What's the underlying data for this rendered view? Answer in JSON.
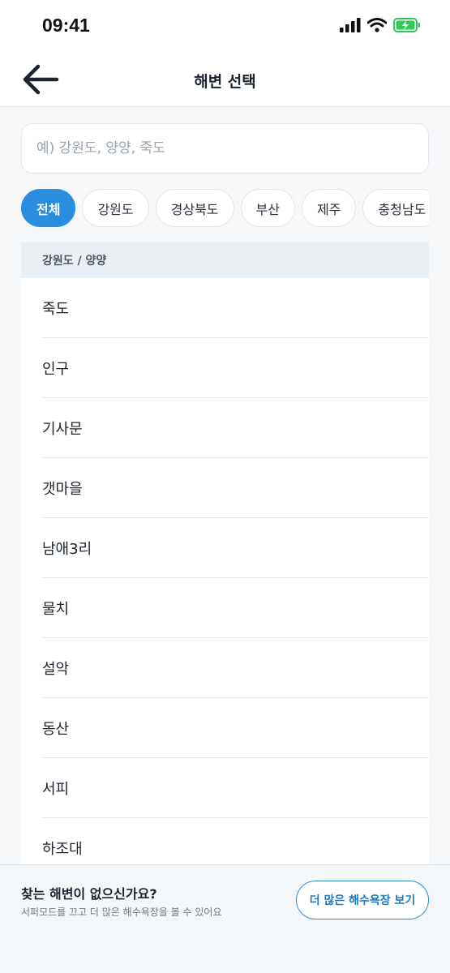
{
  "status_bar": {
    "time": "09:41"
  },
  "header": {
    "title": "해변 선택"
  },
  "search": {
    "placeholder": "예) 강원도, 양양, 죽도",
    "value": ""
  },
  "chips": [
    {
      "label": "전체",
      "active": true
    },
    {
      "label": "강원도",
      "active": false
    },
    {
      "label": "경상북도",
      "active": false
    },
    {
      "label": "부산",
      "active": false
    },
    {
      "label": "제주",
      "active": false
    },
    {
      "label": "충청남도",
      "active": false
    }
  ],
  "list": {
    "section": "강원도 / 양양",
    "items": [
      "죽도",
      "인구",
      "기사문",
      "갯마을",
      "남애3리",
      "물치",
      "설악",
      "동산",
      "서피",
      "하조대"
    ]
  },
  "bottom": {
    "title": "찾는 해변이 없으신가요?",
    "subtitle": "서퍼모드를 끄고 더 많은 해수욕장을 볼 수 있어요",
    "button_label": "더 많은 해수욕장 보기"
  },
  "colors": {
    "accent": "#2b8ddd",
    "battery": "#34c759"
  }
}
